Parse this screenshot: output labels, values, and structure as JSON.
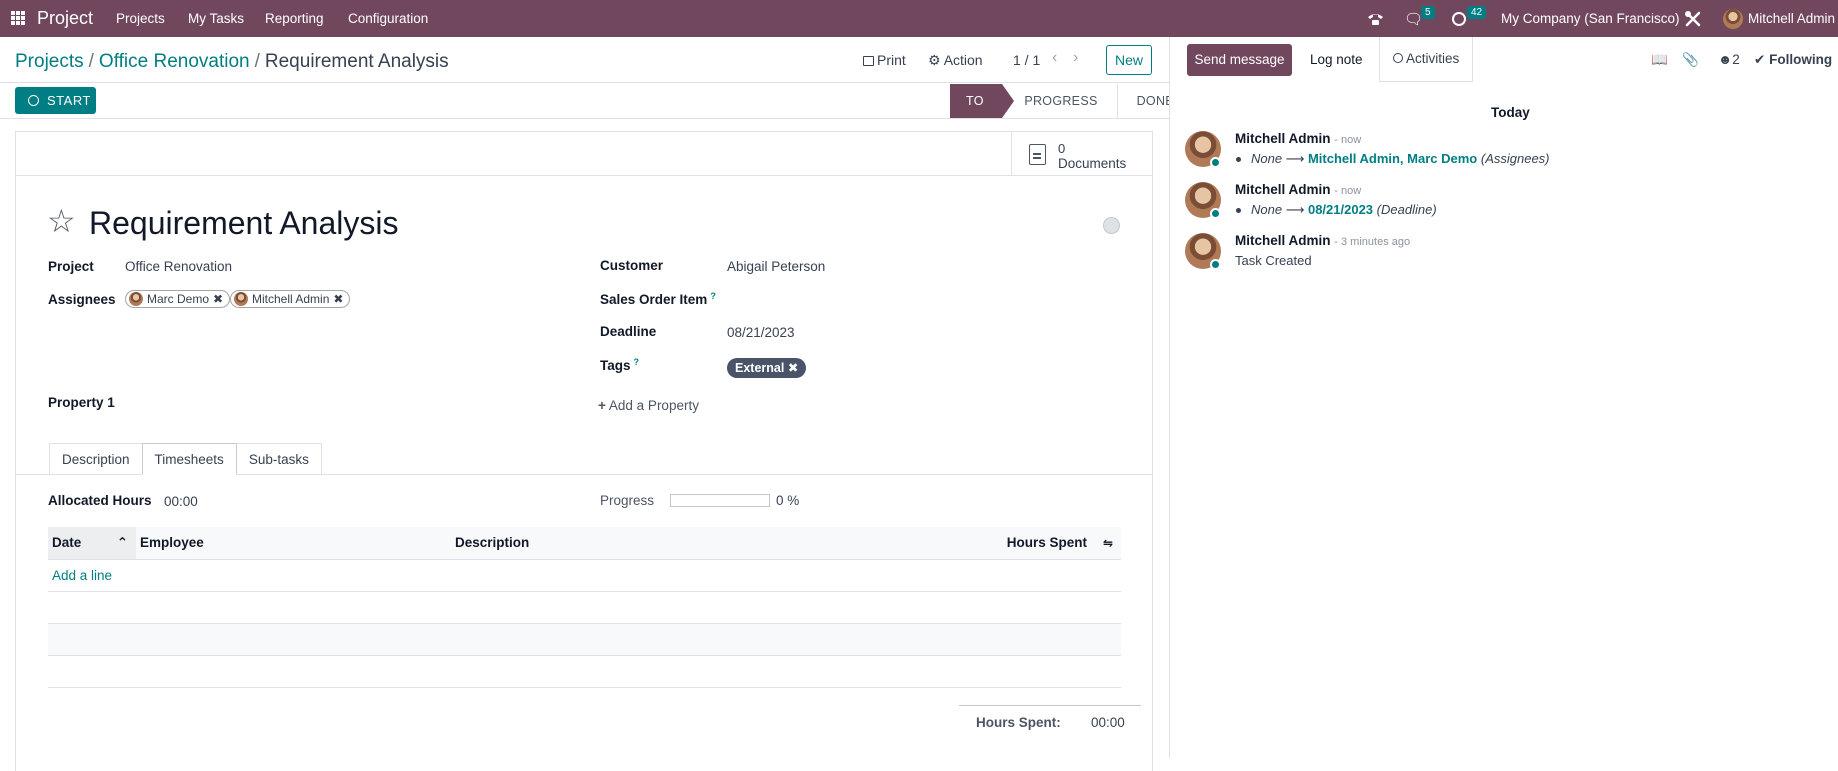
{
  "topnav": {
    "app": "Project",
    "menu": [
      "Projects",
      "My Tasks",
      "Reporting",
      "Configuration"
    ],
    "messages_count": "5",
    "activities_count": "42",
    "company": "My Company (San Francisco)",
    "user": "Mitchell Admin"
  },
  "breadcrumb": {
    "projects": "Projects",
    "project": "Office Renovation",
    "current": "Requirement Analysis"
  },
  "controls": {
    "print": "Print",
    "action": "Action",
    "pager": "1 / 1",
    "new": "New"
  },
  "statusbar": {
    "start": "START",
    "stages": [
      "TO DO",
      "PROGRESS",
      "DONE"
    ],
    "active_stage": "TO DO"
  },
  "smart": {
    "doc_count": "0",
    "doc_label": "Documents"
  },
  "task": {
    "title": "Requirement Analysis",
    "project_label": "Project",
    "project": "Office Renovation",
    "assignees_label": "Assignees",
    "assignees": [
      "Marc Demo",
      "Mitchell Admin"
    ],
    "customer_label": "Customer",
    "customer": "Abigail Peterson",
    "sales_order_label": "Sales Order Item",
    "deadline_label": "Deadline",
    "deadline": "08/21/2023",
    "tags_label": "Tags",
    "tag": "External",
    "property_label": "Property 1",
    "add_property": "Add a Property"
  },
  "tabs": [
    "Description",
    "Timesheets",
    "Sub-tasks"
  ],
  "timesheet": {
    "allocated_label": "Allocated Hours",
    "allocated": "00:00",
    "progress_label": "Progress",
    "progress_value": "0 %",
    "progress_fraction": 0,
    "columns": [
      "Date",
      "Employee",
      "Description",
      "Hours Spent"
    ],
    "add_line": "Add a line",
    "total_label": "Hours Spent:",
    "total": "00:00"
  },
  "chatter": {
    "send_message": "Send message",
    "log_note": "Log note",
    "activities": "Activities",
    "followers_count": "2",
    "following": "Following",
    "today": "Today",
    "messages": [
      {
        "author": "Mitchell Admin",
        "time": "- now",
        "old": "None",
        "new": "Mitchell Admin, Marc Demo",
        "field": "(Assignees)"
      },
      {
        "author": "Mitchell Admin",
        "time": "- now",
        "old": "None",
        "new": "08/21/2023",
        "field": "(Deadline)"
      },
      {
        "author": "Mitchell Admin",
        "time": "- 3 minutes ago",
        "body": "Task Created"
      }
    ]
  },
  "colors": {
    "brand": "#71475e",
    "accent": "#017e84",
    "tag": "#4a5469",
    "following": "#28a745"
  }
}
